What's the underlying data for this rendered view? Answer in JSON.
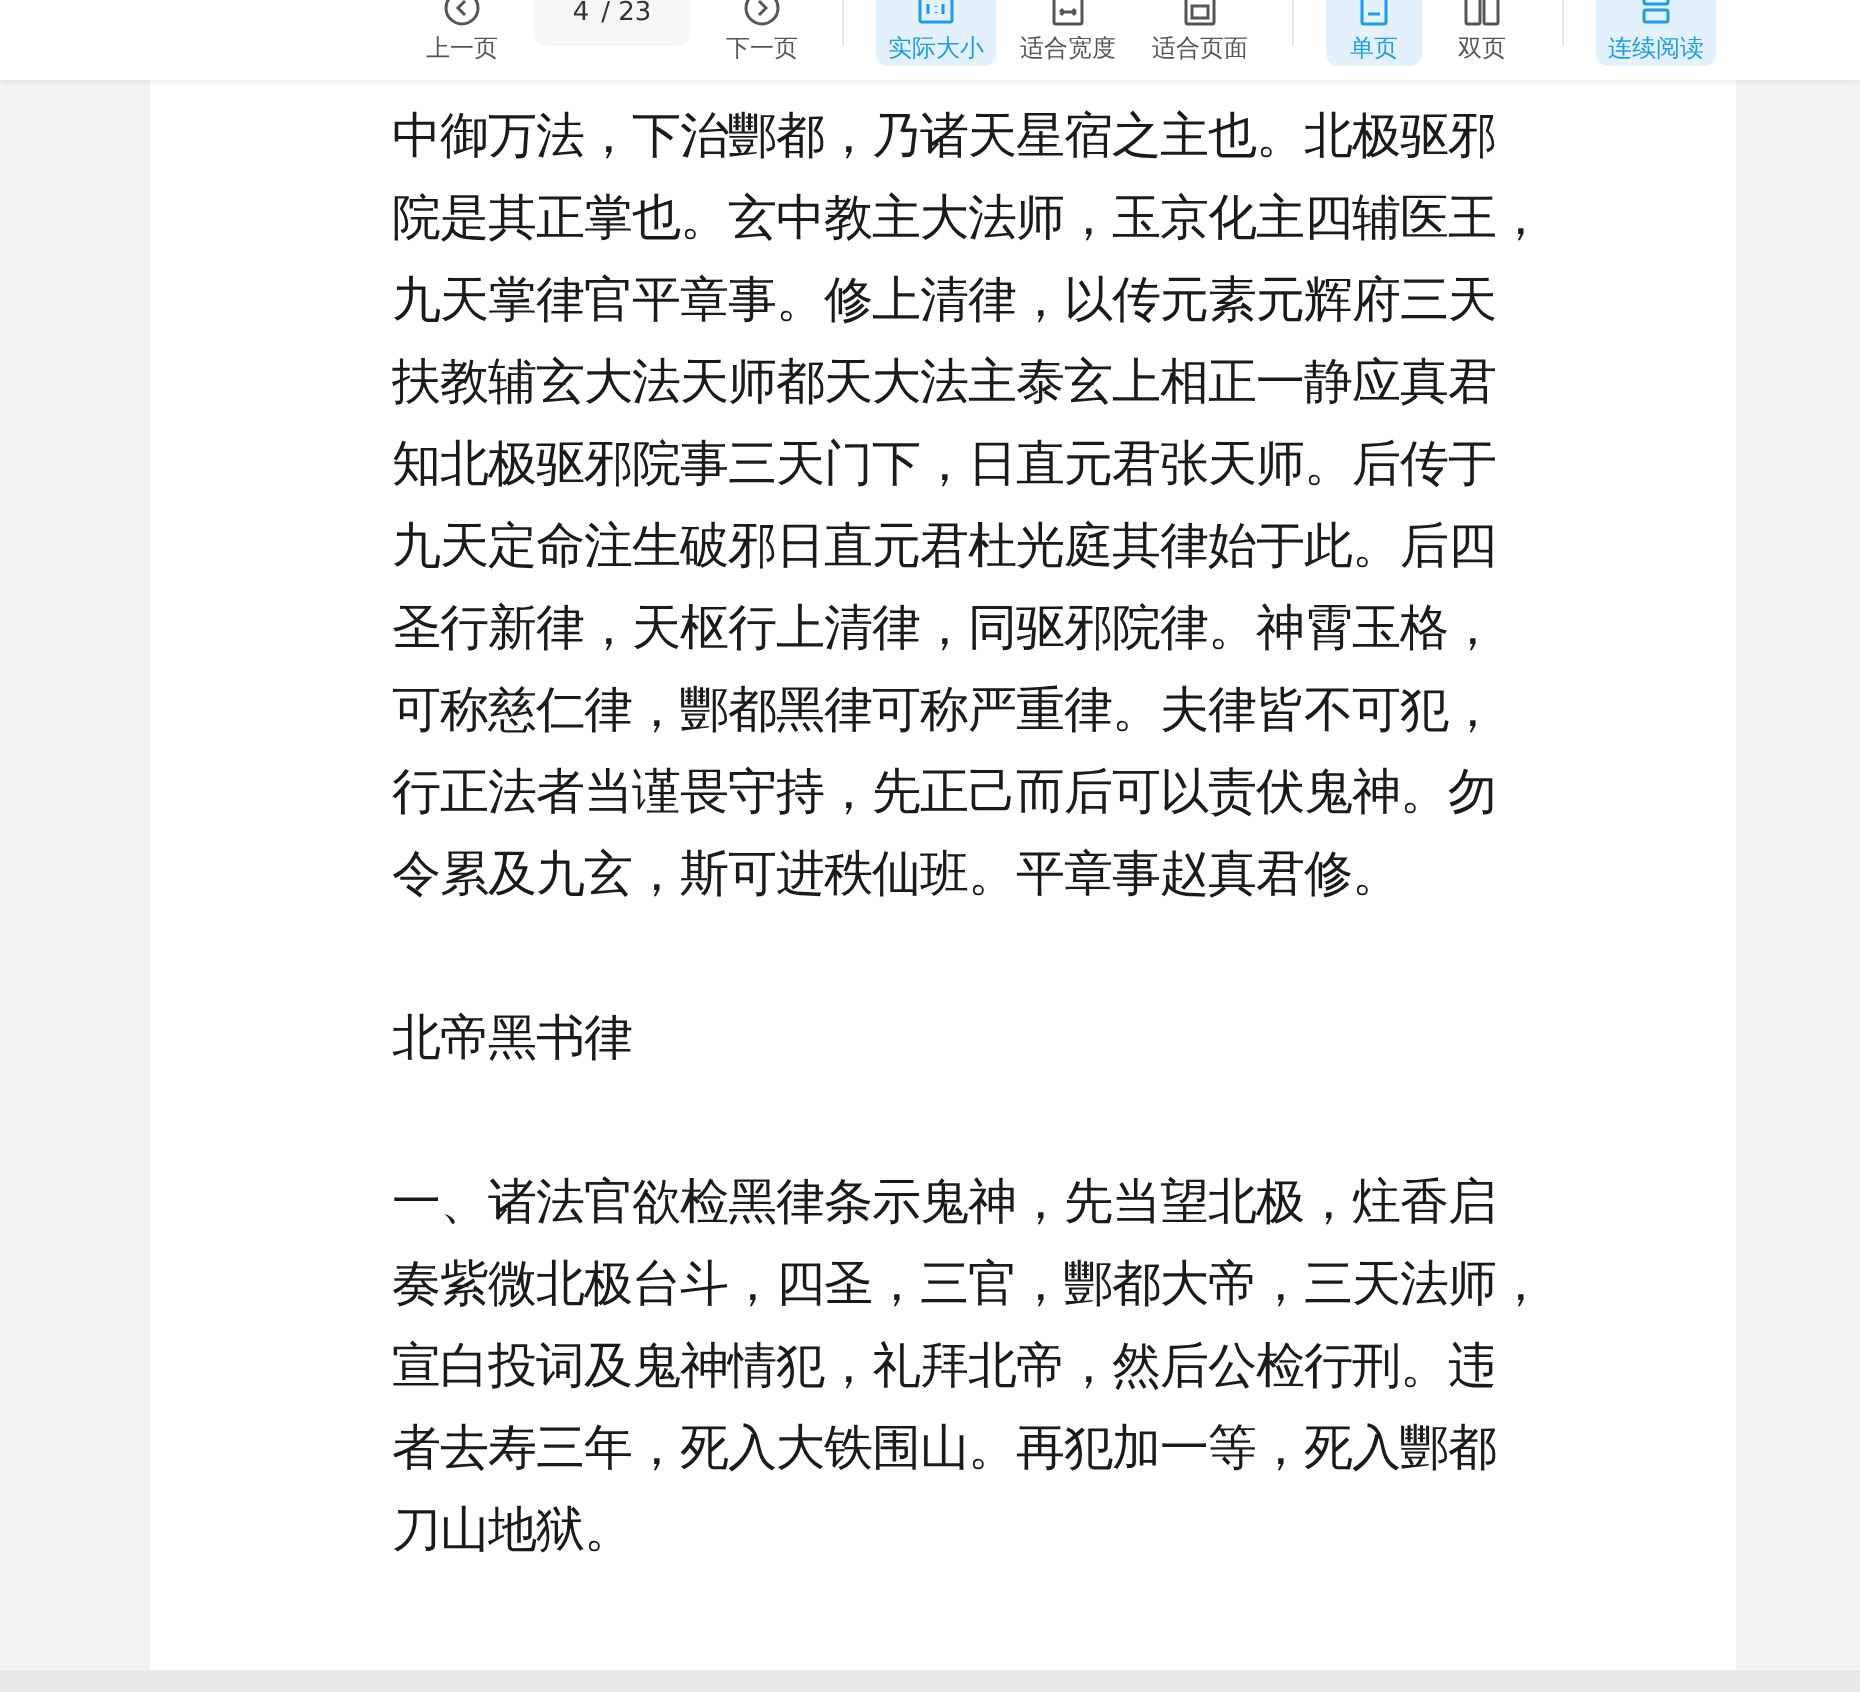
{
  "toolbar": {
    "items": [
      {
        "kind": "button",
        "label": "上一页",
        "selected": false
      },
      {
        "kind": "page",
        "current": "4",
        "total": "/ 23"
      },
      {
        "kind": "button",
        "label": "下一页",
        "selected": false
      },
      {
        "kind": "divider"
      },
      {
        "kind": "button",
        "label": "实际大小",
        "selected": true
      },
      {
        "kind": "button",
        "label": "适合宽度",
        "selected": false
      },
      {
        "kind": "button",
        "label": "适合页面",
        "selected": false
      },
      {
        "kind": "divider"
      },
      {
        "kind": "button",
        "label": "单页",
        "selected": true
      },
      {
        "kind": "button",
        "label": "双页",
        "selected": false
      },
      {
        "kind": "divider"
      },
      {
        "kind": "button",
        "label": "连续阅读",
        "selected": true
      }
    ]
  },
  "document": {
    "paragraphs": [
      [
        "中御万法，下治酆都，乃诸天星宿之主也。北极驱邪",
        "院是其正掌也。玄中教主大法师，玉京化主四辅医王，",
        "九天掌律官平章事。修上清律，以传元素元辉府三天",
        "扶教辅玄大法天师都天大法主泰玄上相正一静应真君",
        "知北极驱邪院事三天门下，日直元君张天师。后传于",
        "九天定命注生破邪日直元君杜光庭其律始于此。后四",
        "圣行新律，天枢行上清律，同驱邪院律。神霄玉格，",
        "可称慈仁律，酆都黑律可称严重律。夫律皆不可犯，",
        "行正法者当谨畏守持，先正己而后可以责伏鬼神。勿",
        "令累及九玄，斯可进秩仙班。平章事赵真君修。"
      ],
      [
        "北帝黑书律"
      ],
      [
        "一、诸法官欲检黑律条示鬼神，先当望北极，炷香启",
        "奏紫微北极台斗，四圣，三官，酆都大帝，三天法师，",
        "宣白投词及鬼神情犯，礼拜北帝，然后公检行刑。违",
        "者去寿三年，死入大铁围山。再犯加一等，死入酆都",
        "刀山地狱。"
      ]
    ]
  }
}
